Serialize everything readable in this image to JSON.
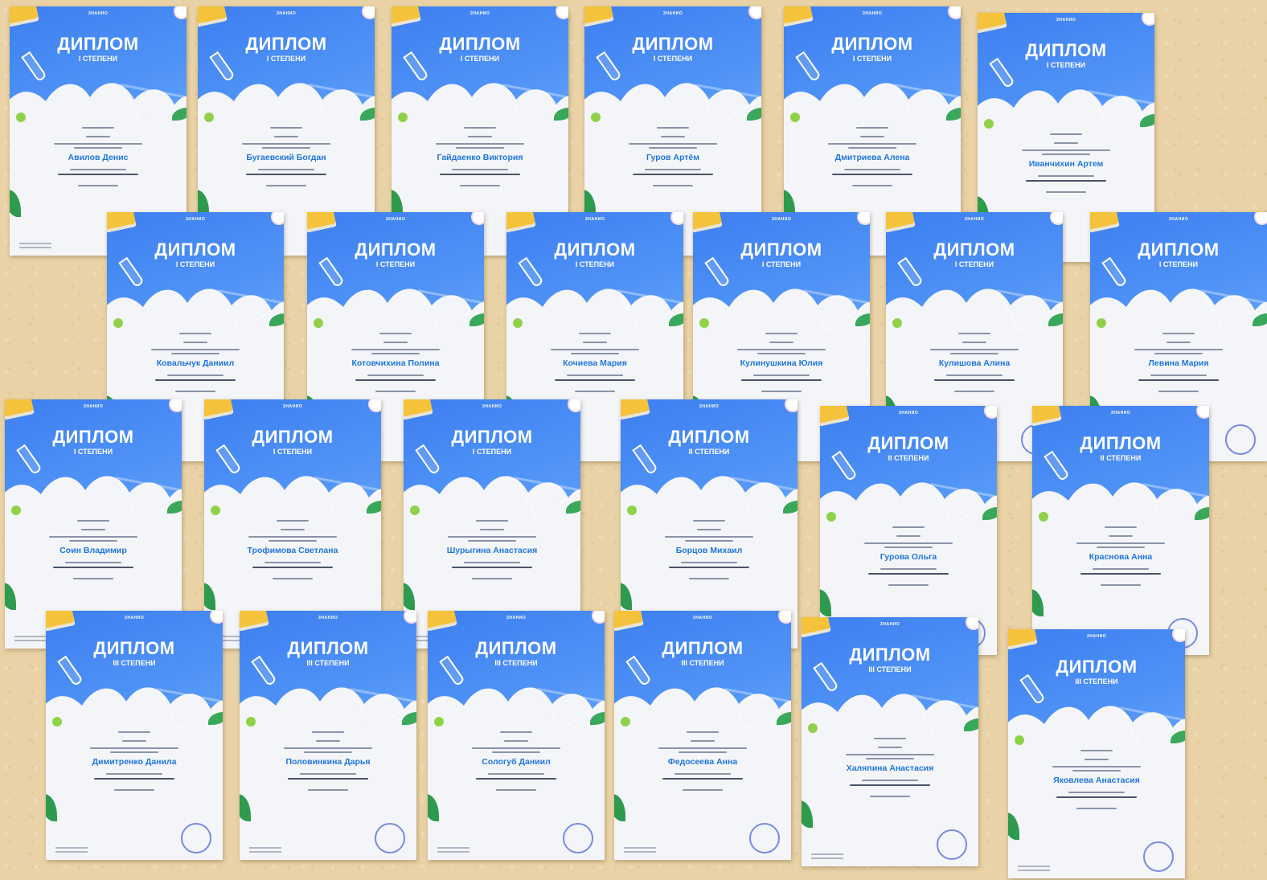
{
  "certificates": [
    {
      "degree": "I СТЕПЕНИ",
      "name": "Авилов Денис"
    },
    {
      "degree": "I СТЕПЕНИ",
      "name": "Бугаевский Богдан"
    },
    {
      "degree": "I СТЕПЕНИ",
      "name": "Гайдаенко Виктория"
    },
    {
      "degree": "I СТЕПЕНИ",
      "name": "Гуров Артём"
    },
    {
      "degree": "I СТЕПЕНИ",
      "name": "Дмитриева Алена"
    },
    {
      "degree": "I СТЕПЕНИ",
      "name": "Иванчихин Артем"
    },
    {
      "degree": "I СТЕПЕНИ",
      "name": "Ковальчук Даниил"
    },
    {
      "degree": "I СТЕПЕНИ",
      "name": "Котовчихина Полина"
    },
    {
      "degree": "I СТЕПЕНИ",
      "name": "Кочиева Мария"
    },
    {
      "degree": "I СТЕПЕНИ",
      "name": "Кулинушкина Юлия"
    },
    {
      "degree": "I СТЕПЕНИ",
      "name": "Кулишова Алина"
    },
    {
      "degree": "I СТЕПЕНИ",
      "name": "Левина Мария"
    },
    {
      "degree": "I СТЕПЕНИ",
      "name": "Соин Владимир"
    },
    {
      "degree": "I СТЕПЕНИ",
      "name": "Трофимова Светлана"
    },
    {
      "degree": "I СТЕПЕНИ",
      "name": "Шурыгина Анастасия"
    },
    {
      "degree": "II СТЕПЕНИ",
      "name": "Борцов Михаил"
    },
    {
      "degree": "II СТЕПЕНИ",
      "name": "Гурова Ольга"
    },
    {
      "degree": "II СТЕПЕНИ",
      "name": "Краснова Анна"
    },
    {
      "degree": "III СТЕПЕНИ",
      "name": "Димитренко Данила"
    },
    {
      "degree": "III СТЕПЕНИ",
      "name": "Половинкина Дарья"
    },
    {
      "degree": "III СТЕПЕНИ",
      "name": "Сологуб Даниил"
    },
    {
      "degree": "III СТЕПЕНИ",
      "name": "Федосеева Анна"
    },
    {
      "degree": "III СТЕПЕНИ",
      "name": "Халяпина Анастасия"
    },
    {
      "degree": "III СТЕПЕНИ",
      "name": "Яковлева Анастасия"
    }
  ],
  "cert_title": "ДИПЛОМ",
  "logo_text": "ЗНАНИО",
  "colors": {
    "accent_blue": "#4a8cf5",
    "name_blue": "#1f76d8",
    "paper_bg": "#e9d3a6",
    "book_yellow": "#f4c33b",
    "leaf_green": "#2e9a4e"
  }
}
